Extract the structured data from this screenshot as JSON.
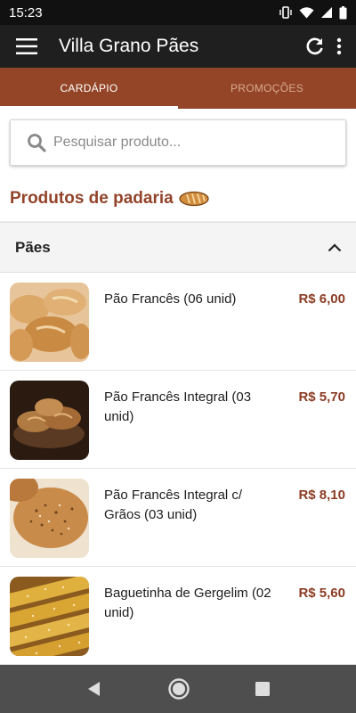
{
  "status_bar": {
    "time": "15:23"
  },
  "app_bar": {
    "title": "Villa Grano Pães",
    "menu_icon": "menu-icon",
    "refresh_icon": "refresh-icon",
    "more_icon": "more-vert-icon"
  },
  "tabs": [
    {
      "label": "CARDÁPIO",
      "active": true
    },
    {
      "label": "PROMOÇÕES",
      "active": false
    }
  ],
  "search": {
    "placeholder": "Pesquisar produto..."
  },
  "section": {
    "title": "Produtos de padaria",
    "icon": "bread-icon"
  },
  "category": {
    "title": "Pães",
    "expanded": true
  },
  "products": [
    {
      "name": "Pão Francês (06 unid)",
      "price": "R$ 6,00",
      "image": "french-bread-photo"
    },
    {
      "name": "Pão Francês Integral (03 unid)",
      "price": "R$ 5,70",
      "image": "whole-wheat-bread-photo"
    },
    {
      "name": "Pão Francês Integral c/ Grãos (03 unid)",
      "price": "R$ 8,10",
      "image": "grain-bread-photo"
    },
    {
      "name": "Baguetinha de Gergelim (02 unid)",
      "price": "R$ 5,60",
      "image": "sesame-baguette-photo"
    }
  ],
  "colors": {
    "accent": "#944527",
    "price": "#8b3b23",
    "appbar": "#1f1f1f"
  }
}
